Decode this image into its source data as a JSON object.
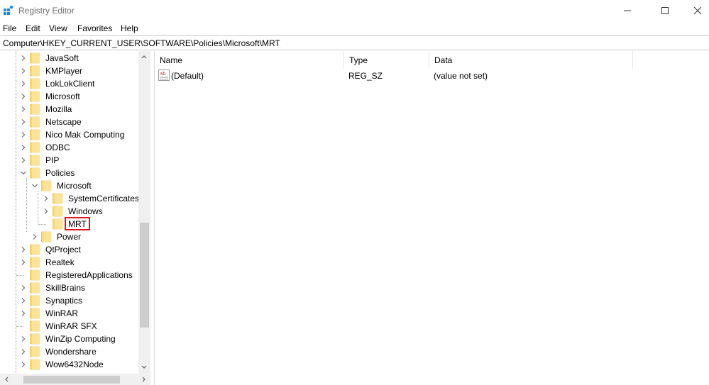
{
  "window": {
    "title": "Registry Editor"
  },
  "menu": [
    "File",
    "Edit",
    "View",
    "Favorites",
    "Help"
  ],
  "address": "Computer\\HKEY_CURRENT_USER\\SOFTWARE\\Policies\\Microsoft\\MRT",
  "tree": [
    {
      "label": "JavaSoft",
      "level": 0,
      "expander": "collapsed"
    },
    {
      "label": "KMPlayer",
      "level": 0,
      "expander": "collapsed"
    },
    {
      "label": "LokLokClient",
      "level": 0,
      "expander": "collapsed"
    },
    {
      "label": "Microsoft",
      "level": 0,
      "expander": "collapsed"
    },
    {
      "label": "Mozilla",
      "level": 0,
      "expander": "collapsed"
    },
    {
      "label": "Netscape",
      "level": 0,
      "expander": "collapsed"
    },
    {
      "label": "Nico Mak Computing",
      "level": 0,
      "expander": "collapsed"
    },
    {
      "label": "ODBC",
      "level": 0,
      "expander": "collapsed"
    },
    {
      "label": "PIP",
      "level": 0,
      "expander": "collapsed"
    },
    {
      "label": "Policies",
      "level": 0,
      "expander": "expanded"
    },
    {
      "label": "Microsoft",
      "level": 1,
      "expander": "expanded"
    },
    {
      "label": "SystemCertificates",
      "level": 2,
      "expander": "collapsed"
    },
    {
      "label": "Windows",
      "level": 2,
      "expander": "collapsed"
    },
    {
      "label": "MRT",
      "level": 2,
      "expander": "none",
      "selected": true
    },
    {
      "label": "Power",
      "level": 1,
      "expander": "collapsed"
    },
    {
      "label": "QtProject",
      "level": 0,
      "expander": "collapsed"
    },
    {
      "label": "Realtek",
      "level": 0,
      "expander": "collapsed"
    },
    {
      "label": "RegisteredApplications",
      "level": 0,
      "expander": "none"
    },
    {
      "label": "SkillBrains",
      "level": 0,
      "expander": "collapsed"
    },
    {
      "label": "Synaptics",
      "level": 0,
      "expander": "collapsed"
    },
    {
      "label": "WinRAR",
      "level": 0,
      "expander": "collapsed"
    },
    {
      "label": "WinRAR SFX",
      "level": 0,
      "expander": "none"
    },
    {
      "label": "WinZip Computing",
      "level": 0,
      "expander": "collapsed"
    },
    {
      "label": "Wondershare",
      "level": 0,
      "expander": "collapsed"
    },
    {
      "label": "Wow6432Node",
      "level": 0,
      "expander": "collapsed"
    }
  ],
  "list": {
    "columns": [
      "Name",
      "Type",
      "Data"
    ],
    "rows": [
      {
        "name": "(Default)",
        "type": "REG_SZ",
        "data": "(value not set)",
        "icon": "reg-sz-icon"
      }
    ]
  },
  "colors": {
    "folder": "#f8d775",
    "folder_dark": "#e8b53e",
    "selected_outline": "#e81123",
    "icon_blue": "#1e88e5"
  }
}
